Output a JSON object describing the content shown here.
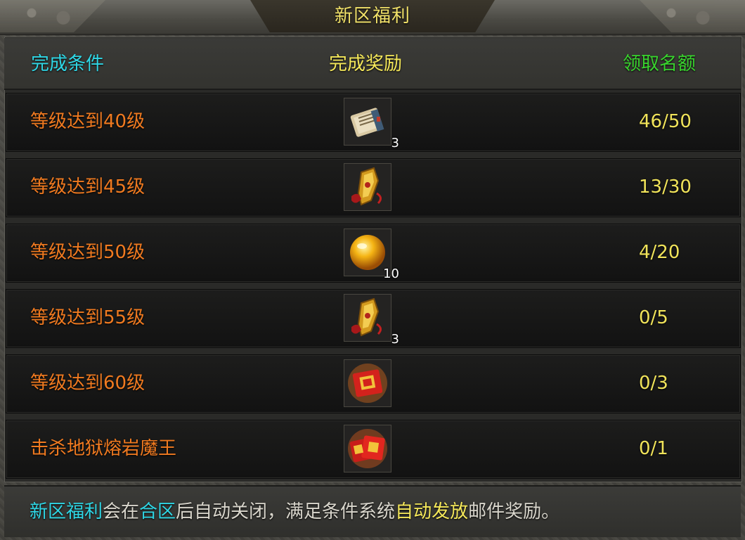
{
  "window": {
    "title": "新区福利"
  },
  "header": {
    "condition": "完成条件",
    "reward": "完成奖励",
    "quota": "领取名额"
  },
  "colors": {
    "title": "#f3e36a",
    "condition_header": "#2fd7e6",
    "reward_header": "#f5e85a",
    "quota_header": "#39d42e",
    "condition_text": "#f07a20",
    "quota_text": "#f0e35a"
  },
  "rows": [
    {
      "condition": "等级达到40级",
      "reward_icon": "scroll-book-icon",
      "reward_count": "3",
      "quota": "46/50"
    },
    {
      "condition": "等级达到45级",
      "reward_icon": "golden-gauntlet-icon",
      "reward_count": "",
      "quota": "13/30"
    },
    {
      "condition": "等级达到50级",
      "reward_icon": "golden-orb-icon",
      "reward_count": "10",
      "quota": "4/20"
    },
    {
      "condition": "等级达到55级",
      "reward_icon": "golden-gauntlet-icon",
      "reward_count": "3",
      "quota": "0/5"
    },
    {
      "condition": "等级达到60级",
      "reward_icon": "red-envelope-icon",
      "reward_count": "",
      "quota": "0/3"
    },
    {
      "condition": "击杀地狱熔岩魔王",
      "reward_icon": "red-envelope-bundle-icon",
      "reward_count": "",
      "quota": "0/1"
    }
  ],
  "footer": {
    "part1": "新区福利",
    "part2": "会在",
    "part3": "合区",
    "part4": "后自动关闭，满足条件系统",
    "part5": "自动发放",
    "part6": "邮件奖励。"
  }
}
